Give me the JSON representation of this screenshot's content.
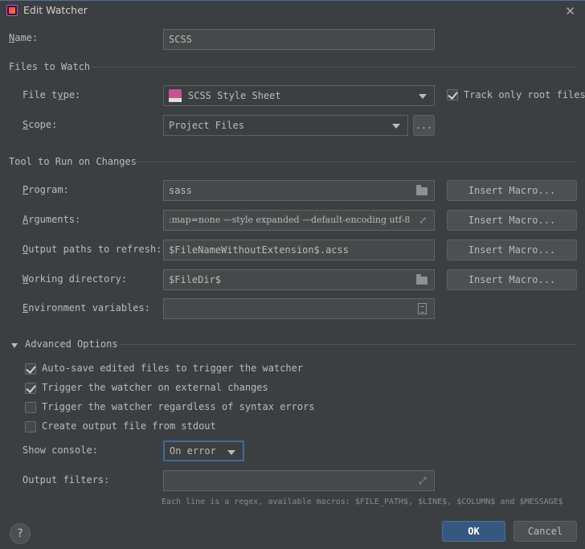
{
  "window": {
    "title": "Edit Watcher",
    "close_glyph": "✕"
  },
  "name": {
    "label": "Name:",
    "value": "SCSS"
  },
  "files_to_watch": {
    "section_title": "Files to Watch",
    "file_type_label": "File type:",
    "file_type_value": "SCSS Style Sheet",
    "file_type_icon": "sass-icon",
    "track_root_label": "Track only root files",
    "track_root_checked": true,
    "scope_label": "Scope:",
    "scope_value": "Project Files",
    "scope_more": "..."
  },
  "tool": {
    "section_title": "Tool to Run on Changes",
    "program_label": "Program:",
    "program_value": "sass",
    "arguments_label": "Arguments:",
    "arguments_value": ":map=none —style expanded —default-encoding utf-8",
    "output_paths_label": "Output paths to refresh:",
    "output_paths_value": "$FileNameWithoutExtension$.acss",
    "working_dir_label": "Working directory:",
    "working_dir_value": "$FileDir$",
    "env_label": "Environment variables:",
    "env_value": "",
    "insert_macro": "Insert Macro..."
  },
  "advanced": {
    "section_title": "Advanced Options",
    "options": [
      {
        "label": "Auto-save edited files to trigger the watcher",
        "checked": true
      },
      {
        "label": "Trigger the watcher on external changes",
        "checked": true
      },
      {
        "label": "Trigger the watcher regardless of syntax errors",
        "checked": false
      },
      {
        "label": "Create output file from stdout",
        "checked": false
      }
    ],
    "show_console_label": "Show console:",
    "show_console_value": "On error",
    "output_filters_label": "Output filters:",
    "output_filters_value": "",
    "hint": "Each line is a regex, available macros: $FILE_PATH$, $LINE$, $COLUMN$ and $MESSAGE$"
  },
  "footer": {
    "help": "?",
    "ok": "OK",
    "cancel": "Cancel"
  },
  "colors": {
    "background": "#3c3f41",
    "field": "#45494a",
    "primary_button": "#365880",
    "focus_border": "#3e6a9c"
  }
}
